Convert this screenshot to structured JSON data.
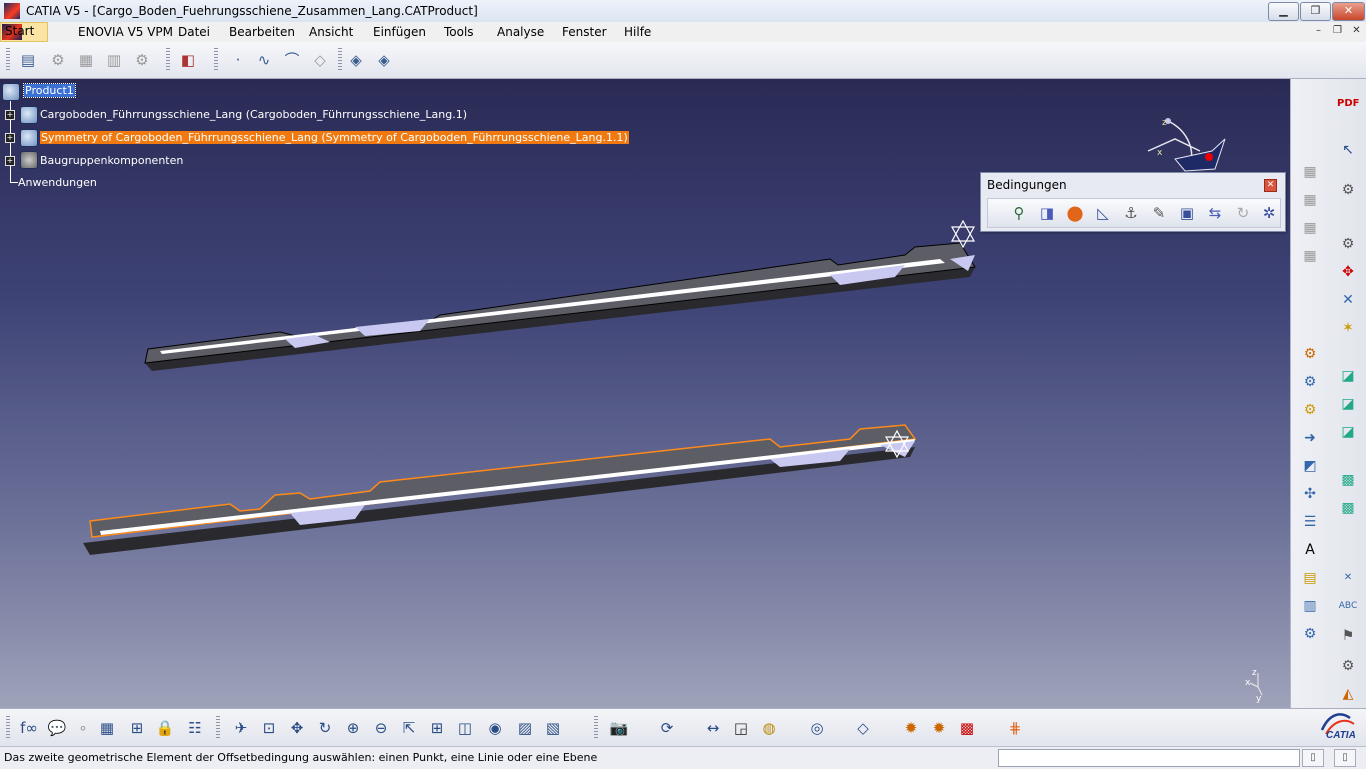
{
  "window": {
    "title": "CATIA V5 - [Cargo_Boden_Fuehrungsschiene_Zusammen_Lang.CATProduct]",
    "min_label": "▁",
    "max_label": "❐",
    "close_label": "✕"
  },
  "menu": {
    "items": [
      "Start",
      "ENOVIA V5 VPM",
      "Datei",
      "Bearbeiten",
      "Ansicht",
      "Einfügen",
      "Tools",
      "Analyse",
      "Fenster",
      "Hilfe"
    ],
    "doc_buttons": [
      "–",
      "❐",
      "✕"
    ]
  },
  "tree": {
    "root": "Product1",
    "children": [
      "Cargoboden_Führrungsschiene_Lang (Cargoboden_Führrungsschiene_Lang.1)",
      "Symmetry of Cargoboden_Führrungsschiene_Lang (Symmetry of Cargoboden_Führrungsschiene_Lang.1.1)",
      "Baugruppenkomponenten",
      "Anwendungen"
    ]
  },
  "bedingungen": {
    "title": "Bedingungen",
    "close": "✕",
    "icons": [
      "coincidence-constraint-icon",
      "contact-constraint-icon",
      "offset-constraint-icon",
      "angle-constraint-icon",
      "fix-component-icon",
      "fix-together-icon",
      "quick-constraint-icon",
      "flexible-subassembly-icon",
      "reconnect-icon",
      "update-constraints-icon"
    ]
  },
  "compass": {
    "x_label": "x",
    "z_label": "z"
  },
  "axis_indicator": {
    "z_label": "z",
    "y_label": "y",
    "x_label": "x"
  },
  "logo": {
    "text": "CATIA"
  },
  "status": {
    "message": "Das zweite geometrische Element der Offsetbedingung auswählen: einen Punkt, eine Linie oder eine Ebene"
  },
  "colors": {
    "selection_blue": "#3a6fd4",
    "highlight_orange": "#f07a10",
    "viewport_top": "#2a2a55",
    "viewport_bottom": "#9ea2b9"
  }
}
